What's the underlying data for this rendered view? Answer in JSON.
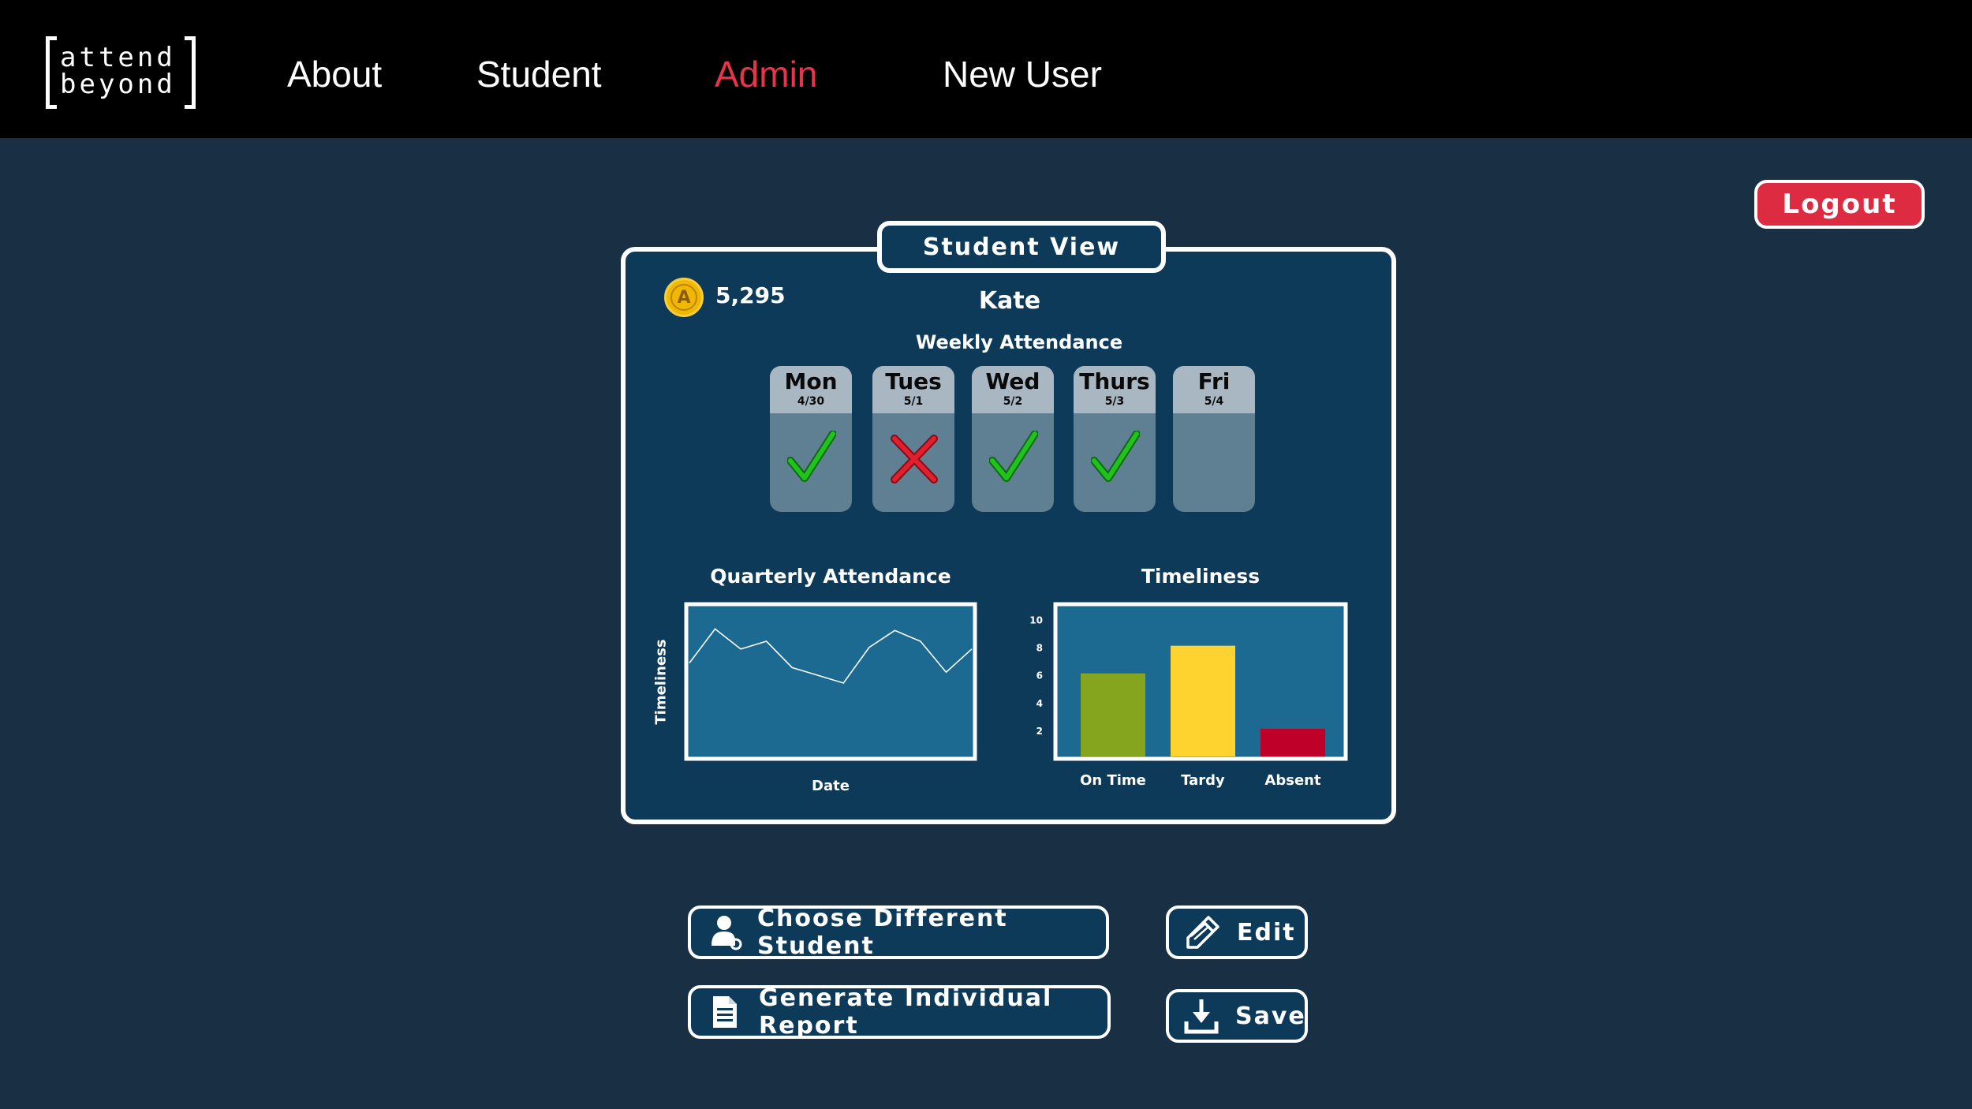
{
  "nav": {
    "logo_line1": "attend",
    "logo_line2": "beyond",
    "items": [
      {
        "label": "About"
      },
      {
        "label": "Student"
      },
      {
        "label": "Admin",
        "active": true
      },
      {
        "label": "New User"
      }
    ],
    "logout_label": "Logout"
  },
  "card": {
    "tab_label": "Student View",
    "points": "5,295",
    "points_icon": "coin-icon",
    "student_name": "Kate",
    "weekly_title": "Weekly Attendance",
    "days": [
      {
        "name": "Mon",
        "date": "4/30",
        "status": "present"
      },
      {
        "name": "Tues",
        "date": "5/1",
        "status": "absent"
      },
      {
        "name": "Wed",
        "date": "5/2",
        "status": "present"
      },
      {
        "name": "Thurs",
        "date": "5/3",
        "status": "present"
      },
      {
        "name": "Fri",
        "date": "5/4",
        "status": "none"
      }
    ]
  },
  "chart_data": [
    {
      "type": "line",
      "title": "Quarterly Attendance",
      "xlabel": "Date",
      "ylabel": "Timeliness",
      "x": [
        1,
        2,
        3,
        4,
        5,
        6,
        7,
        8,
        9,
        10,
        11,
        12
      ],
      "values": [
        6.2,
        8.4,
        7.1,
        7.6,
        5.9,
        5.4,
        4.9,
        7.2,
        8.3,
        7.6,
        5.6,
        7.1
      ],
      "ylim": [
        0,
        10
      ],
      "line_color": "#ffffff",
      "grid": false
    },
    {
      "type": "bar",
      "title": "Timeliness",
      "categories": [
        "On Time",
        "Tardy",
        "Absent"
      ],
      "values": [
        6,
        8,
        2
      ],
      "colors": [
        "#86a51f",
        "#fed22f",
        "#bf0028"
      ],
      "yticks": [
        "2",
        "4",
        "6",
        "8",
        "10"
      ],
      "ylim": [
        0,
        11
      ],
      "grid": false
    }
  ],
  "actions": {
    "choose_student": "Choose Different Student",
    "edit": "Edit",
    "generate_report": "Generate Individual Report",
    "save": "Save"
  },
  "colors": {
    "background": "#193044",
    "card": "#0e3a59",
    "accent_red": "#dd2b42",
    "plot_fill": "#1c6991",
    "present_green": "#22c21c",
    "absent_red": "#e0202e"
  }
}
